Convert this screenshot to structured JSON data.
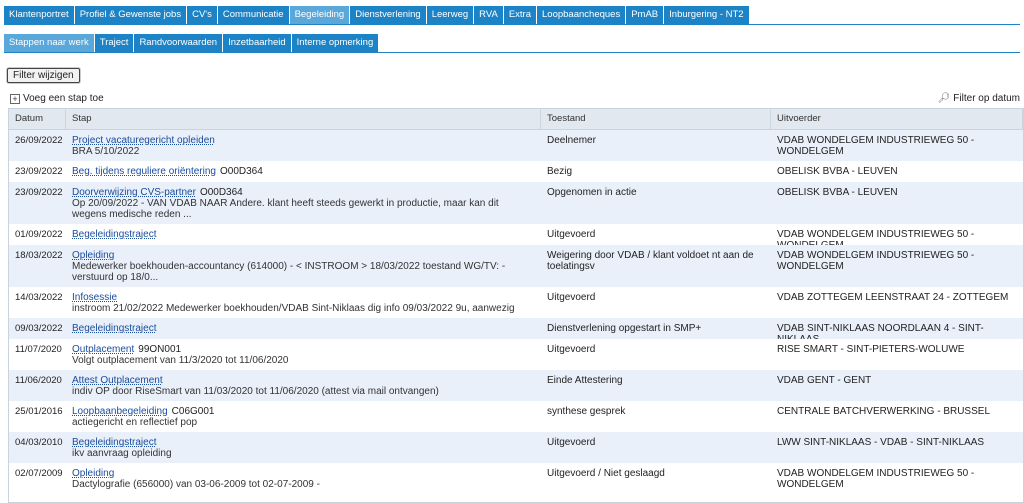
{
  "tabs_primary": [
    {
      "label": "Klantenportret"
    },
    {
      "label": "Profiel & Gewenste jobs"
    },
    {
      "label": "CV's"
    },
    {
      "label": "Communicatie"
    },
    {
      "label": "Begeleiding"
    },
    {
      "label": "Dienstverlening"
    },
    {
      "label": "Leerweg"
    },
    {
      "label": "RVA"
    },
    {
      "label": "Extra"
    },
    {
      "label": "Loopbaancheques"
    },
    {
      "label": "PmAB"
    },
    {
      "label": "Inburgering - NT2"
    }
  ],
  "tabs_primary_active": "Begeleiding",
  "tabs_secondary": [
    {
      "label": "Stappen naar werk"
    },
    {
      "label": "Traject"
    },
    {
      "label": "Randvoorwaarden"
    },
    {
      "label": "Inzetbaarheid"
    },
    {
      "label": "Interne opmerking"
    }
  ],
  "tabs_secondary_active": "Stappen naar werk",
  "filter_button": "Filter wijzigen",
  "add_step": "Voeg een stap toe",
  "filter_date": "Filter op datum",
  "columns": {
    "datum": "Datum",
    "stap": "Stap",
    "toestand": "Toestand",
    "uitvoerder": "Uitvoerder"
  },
  "rows": [
    {
      "datum": "26/09/2022",
      "title": "Project vacaturegericht opleiden",
      "code": "",
      "desc": "BRA 5/10/2022",
      "toestand": "Deelnemer",
      "uitvoerder": "VDAB WONDELGEM INDUSTRIEWEG 50 - WONDELGEM"
    },
    {
      "datum": "23/09/2022",
      "title": "Beg. tijdens reguliere oriëntering",
      "code": "O00D364",
      "desc": "",
      "toestand": "Bezig",
      "uitvoerder": "OBELISK BVBA - LEUVEN"
    },
    {
      "datum": "23/09/2022",
      "title": "Doorverwijzing CVS-partner",
      "code": "O00D364",
      "desc": "Op 20/09/2022 - VAN VDAB NAAR Andere. klant heeft steeds gewerkt in productie, maar kan dit wegens medische reden ...",
      "toestand": "Opgenomen in actie",
      "uitvoerder": "OBELISK BVBA - LEUVEN"
    },
    {
      "datum": "01/09/2022",
      "title": "Begeleidingstraject",
      "code": "",
      "desc": "",
      "toestand": "Uitgevoerd",
      "uitvoerder": "VDAB WONDELGEM INDUSTRIEWEG 50 - WONDELGEM"
    },
    {
      "datum": "18/03/2022",
      "title": "Opleiding",
      "code": "",
      "desc": "Medewerker boekhouden-accountancy (614000) - < INSTROOM > 18/03/2022 toestand WG/TV: - verstuurd op 18/0...",
      "toestand": "Weigering door VDAB / klant voldoet nt aan de toelatingsv",
      "uitvoerder": "VDAB WONDELGEM INDUSTRIEWEG 50 - WONDELGEM"
    },
    {
      "datum": "14/03/2022",
      "title": "Infosessie",
      "code": "",
      "desc": "instroom 21/02/2022 Medewerker boekhouden/VDAB Sint-Niklaas dig info 09/03/2022 9u, aanwezig",
      "toestand": "Uitgevoerd",
      "uitvoerder": "VDAB ZOTTEGEM LEENSTRAAT 24 - ZOTTEGEM"
    },
    {
      "datum": "09/03/2022",
      "title": "Begeleidingstraject",
      "code": "",
      "desc": "",
      "toestand": "Dienstverlening opgestart in SMP+",
      "uitvoerder": "VDAB SINT-NIKLAAS NOORDLAAN 4 - SINT-NIKLAAS"
    },
    {
      "datum": "11/07/2020",
      "title": "Outplacement",
      "code": "99ON001",
      "desc": "Volgt outplacement van 11/3/2020 tot 11/06/2020",
      "toestand": "Uitgevoerd",
      "uitvoerder": "RISE SMART - SINT-PIETERS-WOLUWE"
    },
    {
      "datum": "11/06/2020",
      "title": "Attest Outplacement",
      "code": "",
      "desc": "indiv OP door RiseSmart van 11/03/2020 tot 11/06/2020 (attest via mail ontvangen)",
      "toestand": "Einde Attestering",
      "uitvoerder": "VDAB GENT - GENT"
    },
    {
      "datum": "25/01/2016",
      "title": "Loopbaanbegeleiding",
      "code": "C06G001",
      "desc": "actiegericht en reflectief pop",
      "toestand": "synthese gesprek",
      "uitvoerder": "CENTRALE BATCHVERWERKING - BRUSSEL"
    },
    {
      "datum": "04/03/2010",
      "title": "Begeleidingstraject",
      "code": "",
      "desc": "ikv aanvraag opleiding",
      "toestand": "Uitgevoerd",
      "uitvoerder": "LWW SINT-NIKLAAS - VDAB - SINT-NIKLAAS"
    },
    {
      "datum": "02/07/2009",
      "title": "Opleiding",
      "code": "",
      "desc": "Dactylografie (656000) van 03-06-2009 tot 02-07-2009 -",
      "toestand": "Uitgevoerd / Niet geslaagd",
      "uitvoerder": "VDAB WONDELGEM INDUSTRIEWEG 50 - WONDELGEM"
    }
  ]
}
